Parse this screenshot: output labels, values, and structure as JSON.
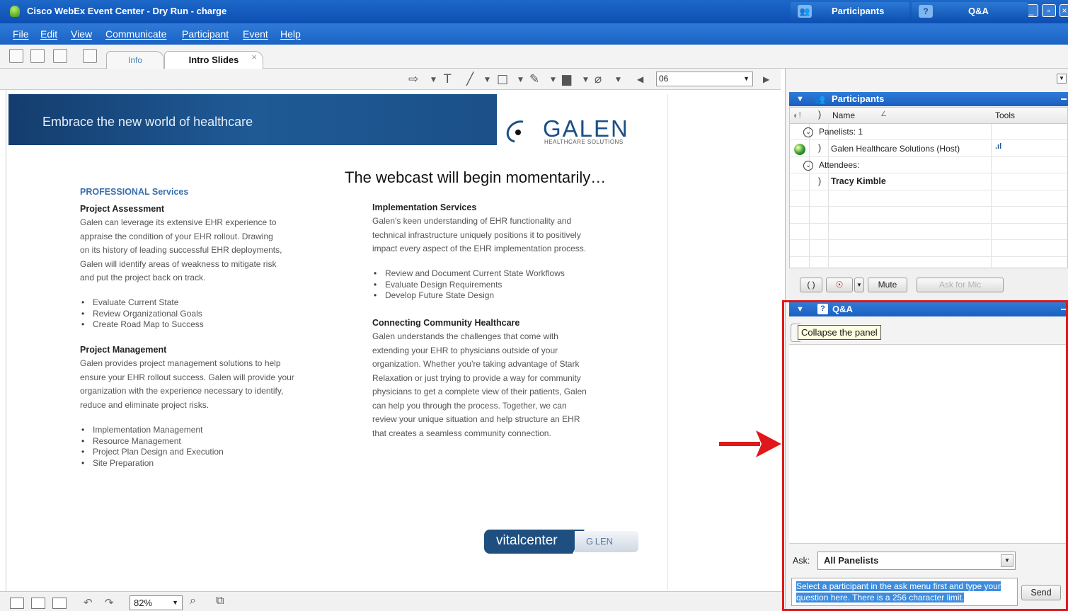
{
  "window": {
    "title": "Cisco WebEx Event Center - Dry Run - charge"
  },
  "menu": [
    "File",
    "Edit",
    "View",
    "Communicate",
    "Participant",
    "Event",
    "Help"
  ],
  "tabs": {
    "info": "Info",
    "active": "Intro Slides",
    "close": "×"
  },
  "annotation": {
    "page_value": "06"
  },
  "slide": {
    "banner": "Embrace the new world of healthcare",
    "logo_word": "GALEN",
    "logo_sub": "HEALTHCARE   SOLUTIONS",
    "headline": "The webcast will begin momentarily…",
    "professional": "PROFESSIONAL Services",
    "assessment": {
      "title": "Project Assessment",
      "lines": [
        "Galen can leverage its extensive EHR experience to",
        "appraise the condition of your EHR rollout. Drawing",
        "on its history of leading successful EHR deployments,",
        "Galen will identify areas of weakness to mitigate risk",
        "and put the project back on track."
      ],
      "bullets": [
        "Evaluate Current State",
        "Review Organizational Goals",
        "Create Road Map to Success"
      ]
    },
    "management": {
      "title": "Project Management",
      "lines": [
        "Galen provides project management solutions to help",
        "ensure your EHR rollout success. Galen will provide your",
        "organization with the experience necessary to identify,",
        "reduce and eliminate project risks."
      ],
      "bullets": [
        "Implementation Management",
        "Resource Management",
        "Project Plan Design and Execution",
        "Site Preparation"
      ]
    },
    "implementation": {
      "title": "Implementation Services",
      "lines": [
        "Galen's keen understanding of EHR functionality and",
        "technical infrastructure uniquely positions it to positively",
        "impact every aspect of the EHR implementation process."
      ],
      "bullets": [
        "Review and Document Current State Workflows",
        "Evaluate Design Requirements",
        "Develop Future State Design"
      ]
    },
    "community": {
      "title": "Connecting Community Healthcare",
      "lines": [
        "Galen understands the challenges that come with",
        "extending your EHR to physicians outside of your",
        "organization. Whether you're taking advantage of Stark",
        "Relaxation or just trying to provide a way for community",
        "physicians to get a complete view of their patients, Galen",
        "can help you through the process. Together, we can",
        "review your unique situation and help structure an EHR",
        "that creates a seamless community connection."
      ]
    },
    "vital_left": "vitalcenter",
    "vital_right": "G LEN"
  },
  "status": {
    "zoom": "82%"
  },
  "panel": {
    "tab_participants": "Participants",
    "tab_qa": "Q&A",
    "participants_header": "Participants",
    "col_name": "Name",
    "col_tools": "Tools",
    "panelists": "Panelists: 1",
    "host": "Galen Healthcare Solutions (Host)",
    "attendees": "Attendees:",
    "attendee": "Tracy Kimble",
    "mute": "Mute",
    "ask_for_mic": "Ask for Mic",
    "qa_header": "Q&A",
    "tooltip": "Collapse the panel",
    "ask_label": "Ask:",
    "ask_value": "All Panelists",
    "ask_placeholder": "Select a participant in the ask menu first and type your question here. There is a 256 character limit.",
    "send": "Send"
  }
}
